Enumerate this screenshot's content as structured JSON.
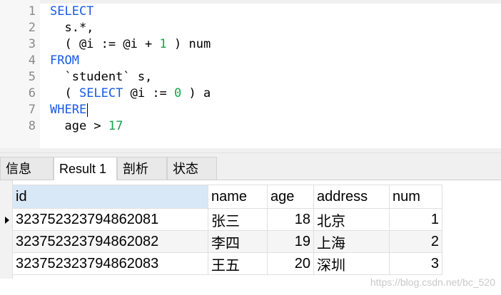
{
  "editor": {
    "line_numbers": [
      "1",
      "2",
      "3",
      "4",
      "5",
      "6",
      "7",
      "8"
    ],
    "lines": [
      [
        {
          "t": "SELECT",
          "c": "kw"
        }
      ],
      [
        {
          "t": "  s.*,",
          "c": ""
        }
      ],
      [
        {
          "t": "  ( @i := @i + ",
          "c": ""
        },
        {
          "t": "1",
          "c": "num"
        },
        {
          "t": " ) num",
          "c": ""
        }
      ],
      [
        {
          "t": "FROM",
          "c": "kw"
        }
      ],
      [
        {
          "t": "  `student` s,",
          "c": ""
        }
      ],
      [
        {
          "t": "  ( ",
          "c": ""
        },
        {
          "t": "SELECT",
          "c": "kw"
        },
        {
          "t": " @i := ",
          "c": ""
        },
        {
          "t": "0",
          "c": "num"
        },
        {
          "t": " ) a",
          "c": ""
        }
      ],
      [
        {
          "t": "WHERE",
          "c": "kw"
        }
      ],
      [
        {
          "t": "  age > ",
          "c": ""
        },
        {
          "t": "17",
          "c": "num"
        }
      ]
    ],
    "caret_line": 7
  },
  "tabs": [
    {
      "label": "信息",
      "active": false
    },
    {
      "label": "Result 1",
      "active": true
    },
    {
      "label": "剖析",
      "active": false
    },
    {
      "label": "状态",
      "active": false
    }
  ],
  "results": {
    "columns": [
      "id",
      "name",
      "age",
      "address",
      "num"
    ],
    "rows": [
      [
        "323752323794862081",
        "张三",
        "18",
        "北京",
        "1"
      ],
      [
        "323752323794862082",
        "李四",
        "19",
        "上海",
        "2"
      ],
      [
        "323752323794862083",
        "王五",
        "20",
        "深圳",
        "3"
      ]
    ],
    "current_row": 1
  },
  "watermark": "https://blog.csdn.net/bc_520",
  "colors": {
    "keyword": "#1a5ae6",
    "number": "#13a34b",
    "selected_header": "#d9e8f7"
  }
}
